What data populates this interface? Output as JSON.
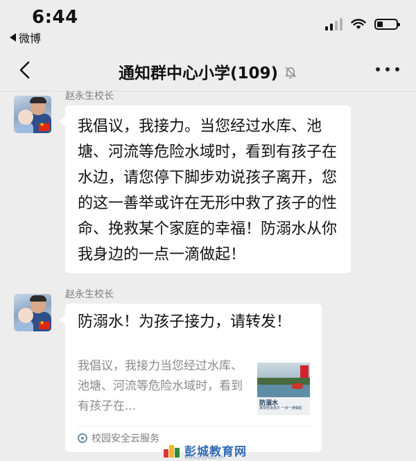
{
  "status_bar": {
    "time": "6:44",
    "back_app": "微博"
  },
  "nav": {
    "title": "通知群中心小学(109)",
    "icons": [
      "back-arrow-icon",
      "mute-bell-icon",
      "more-dots-icon"
    ]
  },
  "messages": [
    {
      "sender": "赵永生校长",
      "text": "我倡议，我接力。当您经过水库、池塘、河流等危险水域时，看到有孩子在水边，请您停下脚步劝说孩子离开，您的这一善举或许在无形中救了孩子的性命、挽救某个家庭的幸福！防溺水从你我身边的一点一滴做起！"
    },
    {
      "sender": "赵永生校长",
      "card": {
        "title": "防溺水！为孩子接力，请转发！",
        "description": "我倡议，我接力当您经过水库、池塘、河流等危险水域时，看到有孩子在...",
        "thumbnail_title": "防溺水",
        "thumbnail_subtitle": "真情告诉孩子  一点一滴做起",
        "source": "校园安全云服务"
      }
    }
  ],
  "watermark": {
    "text": "彭城教育网",
    "url": "www.pcjyedu.cn"
  },
  "colors": {
    "background": "#ededed",
    "bubble": "#ffffff",
    "flag_red": "#de2910",
    "watermark_blue": "#2e6bb8"
  }
}
